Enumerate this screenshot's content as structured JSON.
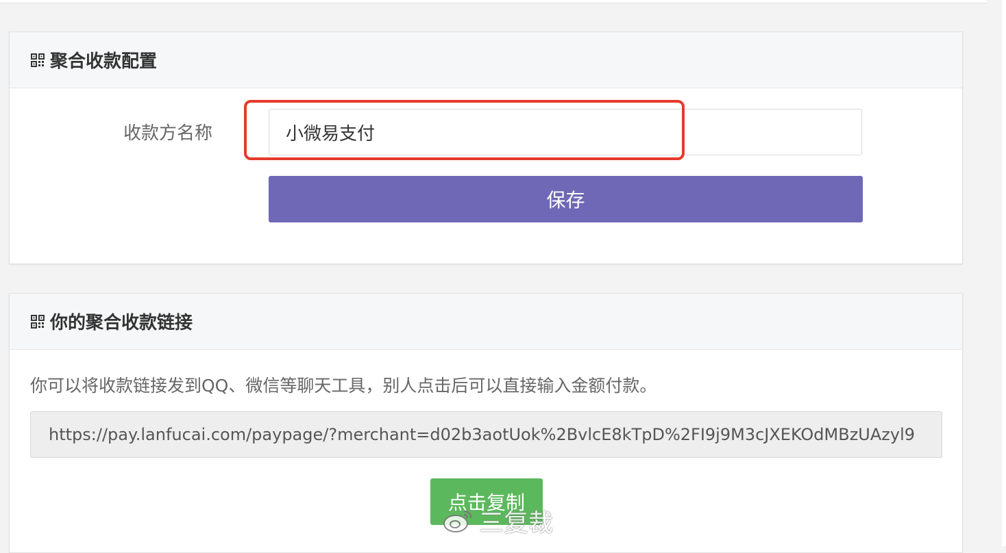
{
  "panels": {
    "config": {
      "title": "聚合收款配置",
      "icon": "qrcode-icon",
      "label": "收款方名称",
      "input_value": "小微易支付",
      "save_label": "保存"
    },
    "link": {
      "title": "你的聚合收款链接",
      "icon": "qrcode-icon",
      "description": "你可以将收款链接发到QQ、微信等聊天工具，别人点击后可以直接输入金额付款。",
      "url": "https://pay.lanfucai.com/paypage/?merchant=d02b3aotUok%2BvlcE8kTpD%2FI9j9M3cJXEKOdMBzUAzyl9",
      "copy_label": "点击复制"
    }
  },
  "watermark": {
    "icon": "weibo-icon",
    "text": "三复裁"
  },
  "colors": {
    "primary": "#6e68b6",
    "success": "#5cb85c",
    "highlight": "#e53a2b"
  }
}
